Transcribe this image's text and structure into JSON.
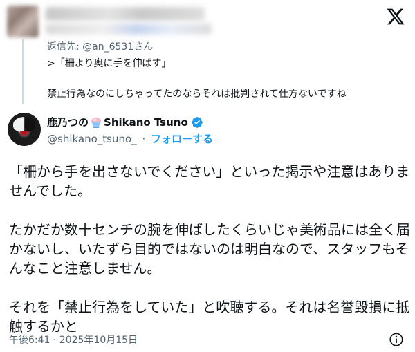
{
  "reply": {
    "reply_to": "返信先: @an_6531さん",
    "quote": ">「柵より奥に手を伸ばす」",
    "text": "禁止行為なのにしちゃってたのならそれは批判されて仕方ないですね"
  },
  "tweet": {
    "author_name_prefix": "鹿乃つの",
    "author_name_suffix": "Shikano Tsuno",
    "handle": "@shikano_tsuno_",
    "separator": "·",
    "follow_label": "フォローする",
    "paragraphs": [
      "「柵から手を出さないでください」といった掲示や注意はありませんでした。",
      "たかだか数十センチの腕を伸ばしたくらいじゃ美術品には全く届かないし、いたずら目的ではないのは明白なので、スタッフもそんなこと注意しません。",
      "それを「禁止行為をしていた」と吹聴する。それは名誉毀損に抵触するかと"
    ],
    "timestamp": "午後6:41 · 2025年10月15日"
  },
  "colors": {
    "accent": "#1d9bf0",
    "muted": "#536471",
    "text": "#0f1419"
  },
  "icons": [
    "x-logo-icon",
    "shaved-ice-emoji-icon",
    "verified-badge-icon",
    "info-icon"
  ]
}
